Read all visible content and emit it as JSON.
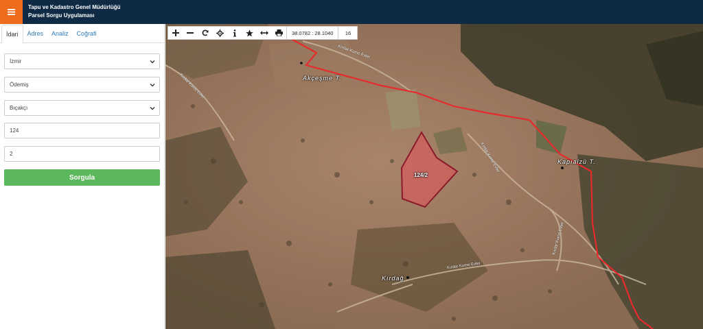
{
  "header": {
    "title_line1": "Tapu ve Kadastro Genel Müdürlüğü",
    "title_line2": "Parsel Sorgu Uygulaması"
  },
  "sidebar": {
    "tabs": [
      {
        "label": "İdari",
        "active": true
      },
      {
        "label": "Adres",
        "active": false
      },
      {
        "label": "Analiz",
        "active": false
      },
      {
        "label": "Coğrafi",
        "active": false
      }
    ],
    "form": {
      "province": "İzmir",
      "district": "Ödemiş",
      "neighborhood": "Bıçakçı",
      "block": "124",
      "parcel": "2",
      "submit_label": "Sorgula"
    }
  },
  "map": {
    "toolbar": {
      "icons": [
        "zoom-in-icon",
        "zoom-out-icon",
        "refresh-icon",
        "locate-icon",
        "info-icon",
        "star-icon",
        "measure-icon",
        "print-icon"
      ],
      "coordinates": "38.0782 : 28.1040",
      "zoom_level": "16"
    },
    "labels": {
      "place1": "Akçeşme T.",
      "place2": "Kapıalzü T.",
      "place3": "Kırdağ",
      "road1": "Kırdar Kume Evler",
      "road2": "Kırdar Kume Evler",
      "road3": "Kırdar Kume Evler",
      "road4": "Kırdar Kume Evler",
      "road5": "Kırdar Kume Evler",
      "parcel": "124/2"
    },
    "colors": {
      "boundary": "#e52b2b",
      "parcel_fill": "#e2525a",
      "parcel_stroke": "#8c1a2a"
    }
  }
}
